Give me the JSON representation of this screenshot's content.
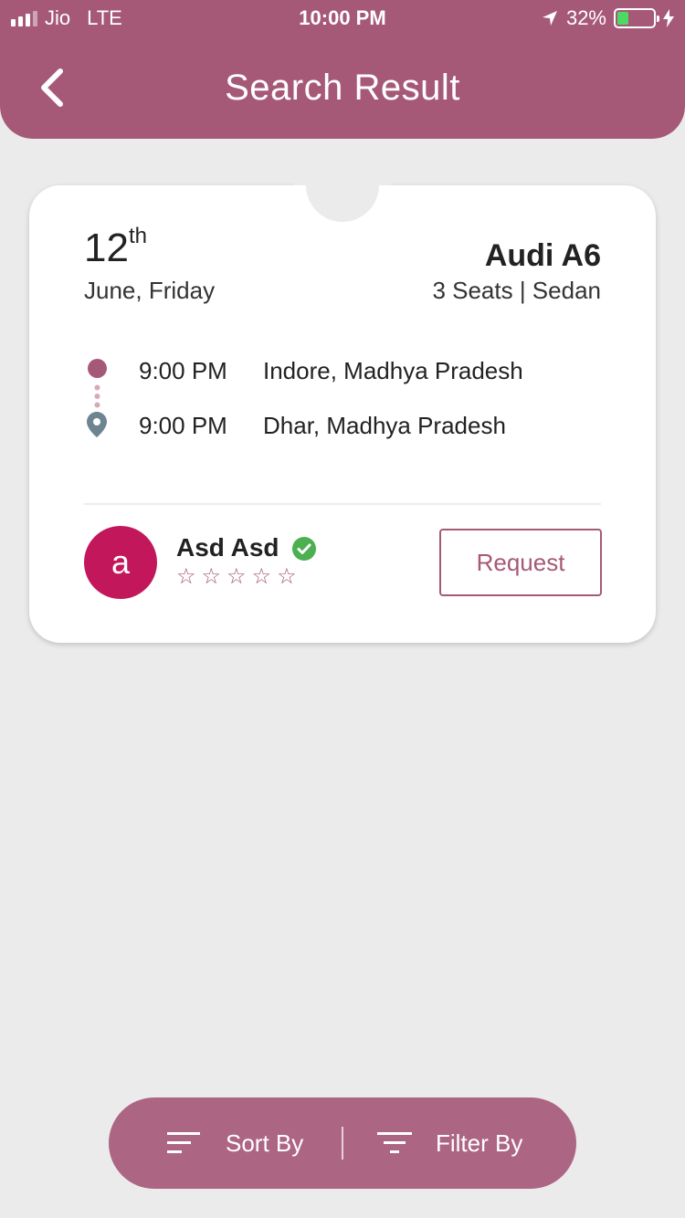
{
  "status_bar": {
    "carrier": "Jio",
    "network": "LTE",
    "time": "10:00 PM",
    "battery": "32%",
    "battery_level": 0.32,
    "signal_bars": 3
  },
  "header": {
    "title": "Search Result",
    "back_icon": "chevron-left-icon"
  },
  "ride": {
    "day": "12",
    "day_suffix": "th",
    "month_day": "June, Friday",
    "car_name": "Audi A6",
    "car_info": "3 Seats | Sedan",
    "pickup_time": "9:00 PM",
    "pickup_place": "Indore, Madhya Pradesh",
    "drop_time": "9:00 PM",
    "drop_place": "Dhar, Madhya Pradesh",
    "driver_initial": "a",
    "driver_name": "Asd Asd",
    "rating": 0,
    "rating_max": 5,
    "request_label": "Request"
  },
  "bottom_bar": {
    "sort_label": "Sort By",
    "filter_label": "Filter By"
  },
  "colors": {
    "primary": "#a65977",
    "avatar": "#c2185b",
    "verified": "#4caf50",
    "background": "#ebebeb"
  }
}
